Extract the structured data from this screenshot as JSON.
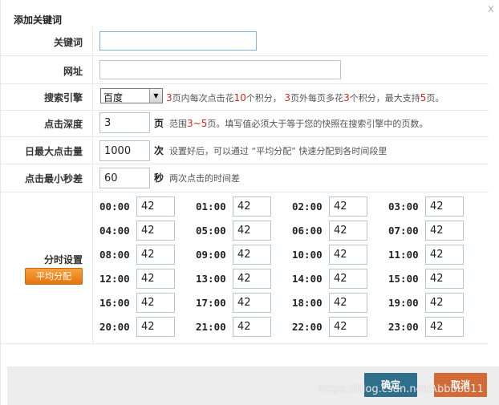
{
  "dialog": {
    "title": "添加关键词",
    "close": "x"
  },
  "form": {
    "keyword": {
      "label": "关键词",
      "value": ""
    },
    "url": {
      "label": "网址",
      "value": ""
    },
    "engine": {
      "label": "搜索引擎",
      "selected": "百度",
      "hint_parts": [
        "3",
        "页内每次点击花",
        "10",
        "个积分， ",
        "3",
        "页外每页多花",
        "3",
        "个积分，最大支持",
        "5",
        "页。"
      ]
    },
    "depth": {
      "label": "点击深度",
      "value": "3",
      "unit": "页",
      "hint_parts": [
        "范围",
        "3~5",
        "页。填写值必须大于等于您的快照在搜索引擎中的页数。"
      ]
    },
    "daily_max": {
      "label": "日最大点击量",
      "value": "1000",
      "unit": "次",
      "hint": "设置好后，可以通过 “平均分配” 快速分配到各时间段里"
    },
    "min_seconds": {
      "label": "点击最小秒差",
      "value": "60",
      "unit": "秒",
      "hint": "两次点击的时间差"
    },
    "schedule": {
      "label": "分时设置",
      "avg_button": "平均分配",
      "slots": [
        {
          "time": "00:00",
          "value": "42"
        },
        {
          "time": "01:00",
          "value": "42"
        },
        {
          "time": "02:00",
          "value": "42"
        },
        {
          "time": "03:00",
          "value": "42"
        },
        {
          "time": "04:00",
          "value": "42"
        },
        {
          "time": "05:00",
          "value": "42"
        },
        {
          "time": "06:00",
          "value": "42"
        },
        {
          "time": "07:00",
          "value": "42"
        },
        {
          "time": "08:00",
          "value": "42"
        },
        {
          "time": "09:00",
          "value": "42"
        },
        {
          "time": "10:00",
          "value": "42"
        },
        {
          "time": "11:00",
          "value": "42"
        },
        {
          "time": "12:00",
          "value": "42"
        },
        {
          "time": "13:00",
          "value": "42"
        },
        {
          "time": "14:00",
          "value": "42"
        },
        {
          "time": "15:00",
          "value": "42"
        },
        {
          "time": "16:00",
          "value": "42"
        },
        {
          "time": "17:00",
          "value": "42"
        },
        {
          "time": "18:00",
          "value": "42"
        },
        {
          "time": "19:00",
          "value": "42"
        },
        {
          "time": "20:00",
          "value": "42"
        },
        {
          "time": "21:00",
          "value": "42"
        },
        {
          "time": "22:00",
          "value": "42"
        },
        {
          "time": "23:00",
          "value": "42"
        }
      ]
    }
  },
  "buttons": {
    "ok": "确定",
    "cancel": "取消"
  },
  "watermark": "https://blog.csdn.net/Abbbbb11",
  "colors": {
    "accent_red": "#cc2a1e",
    "ok_button": "#2f6f8c",
    "cancel_button": "#d46a36",
    "avg_button": "#f08a22"
  }
}
